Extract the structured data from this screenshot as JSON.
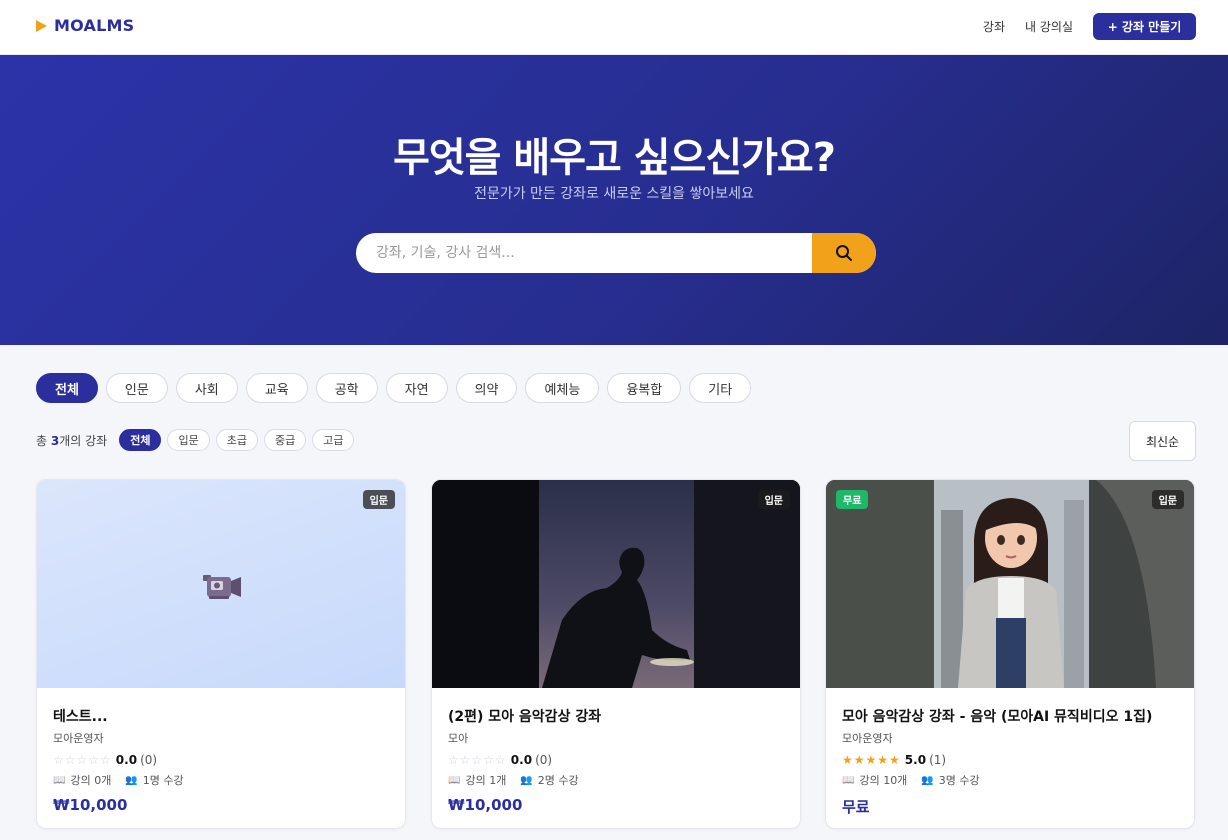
{
  "header": {
    "logo": "MOALMS",
    "nav": [
      "강좌",
      "내 강의실"
    ],
    "create_label": "+ 강좌 만들기"
  },
  "hero": {
    "title": "무엇을 배우고 싶으신가요?",
    "subtitle": "전문가가 만든 강좌로 새로운 스킬을 쌓아보세요",
    "search_placeholder": "강좌, 기술, 강사 검색..."
  },
  "categories": [
    "전체",
    "인문",
    "사회",
    "교육",
    "공학",
    "자연",
    "의약",
    "예체능",
    "융복합",
    "기타"
  ],
  "active_category": 0,
  "filter": {
    "total_prefix": "총 ",
    "total_count": "3",
    "total_suffix": "개의 강좌",
    "levels": [
      "전체",
      "입문",
      "초급",
      "중급",
      "고급"
    ],
    "active_level": 0,
    "sort_label": "최신순"
  },
  "courses": [
    {
      "title": "테스트...",
      "instructor": "모아운영자",
      "stars": "☆☆☆☆☆",
      "rating": "0.0",
      "reviews": "(0)",
      "lectures": "강의 0개",
      "students": "1명 수강",
      "price": "₩10,000",
      "level": "입문",
      "free_badge": ""
    },
    {
      "title": "(2편) 모아 음악감상 강좌",
      "instructor": "모아",
      "stars": "☆☆☆☆☆",
      "rating": "0.0",
      "reviews": "(0)",
      "lectures": "강의 1개",
      "students": "2명 수강",
      "price": "₩10,000",
      "level": "입문",
      "free_badge": ""
    },
    {
      "title": "모아 음악감상 강좌 - 음악 (모아AI 뮤직비디오 1집)",
      "instructor": "모아운영자",
      "stars": "★★★★★",
      "rating": "5.0",
      "reviews": "(1)",
      "lectures": "강의 10개",
      "students": "3명 수강",
      "price": "무료",
      "level": "입문",
      "free_badge": "무료"
    }
  ],
  "colors": {
    "brand": "#2b2f9e",
    "accent": "#f2a11a",
    "free": "#1fb86a"
  }
}
